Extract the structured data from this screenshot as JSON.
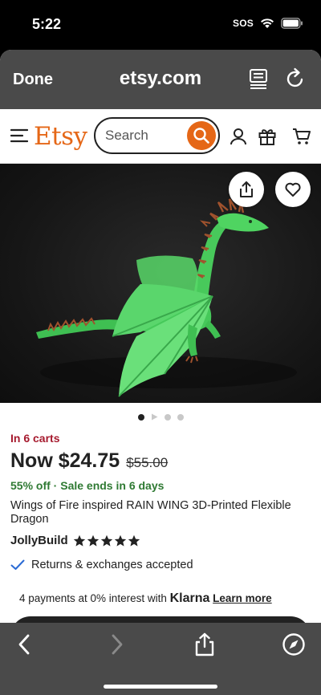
{
  "status_bar": {
    "time": "5:22",
    "sos": "SOS"
  },
  "browser": {
    "done_label": "Done",
    "domain": "etsy.com"
  },
  "header": {
    "logo": "Etsy",
    "search_placeholder": "Search"
  },
  "product": {
    "carts": "In 6 carts",
    "price": "Now $24.75",
    "original_price": "$55.00",
    "sale_text": "55% off · Sale ends in 6 days",
    "title": "Wings of Fire inspired RAIN WING 3D-Printed Flexible Dragon",
    "shop_name": "JollyBuild",
    "rating_stars": 5,
    "returns_text": "Returns & exchanges accepted",
    "installments_text": "4 payments at 0% interest with ",
    "installments_brand": "Klarna",
    "learn_more": "Learn more",
    "image_count": 4,
    "image_active_index": 0
  },
  "colors": {
    "etsy_orange": "#e56717",
    "carts_red": "#a61a2e",
    "sale_green": "#2f7a33",
    "toolbar_gray": "#4a4a4a"
  }
}
